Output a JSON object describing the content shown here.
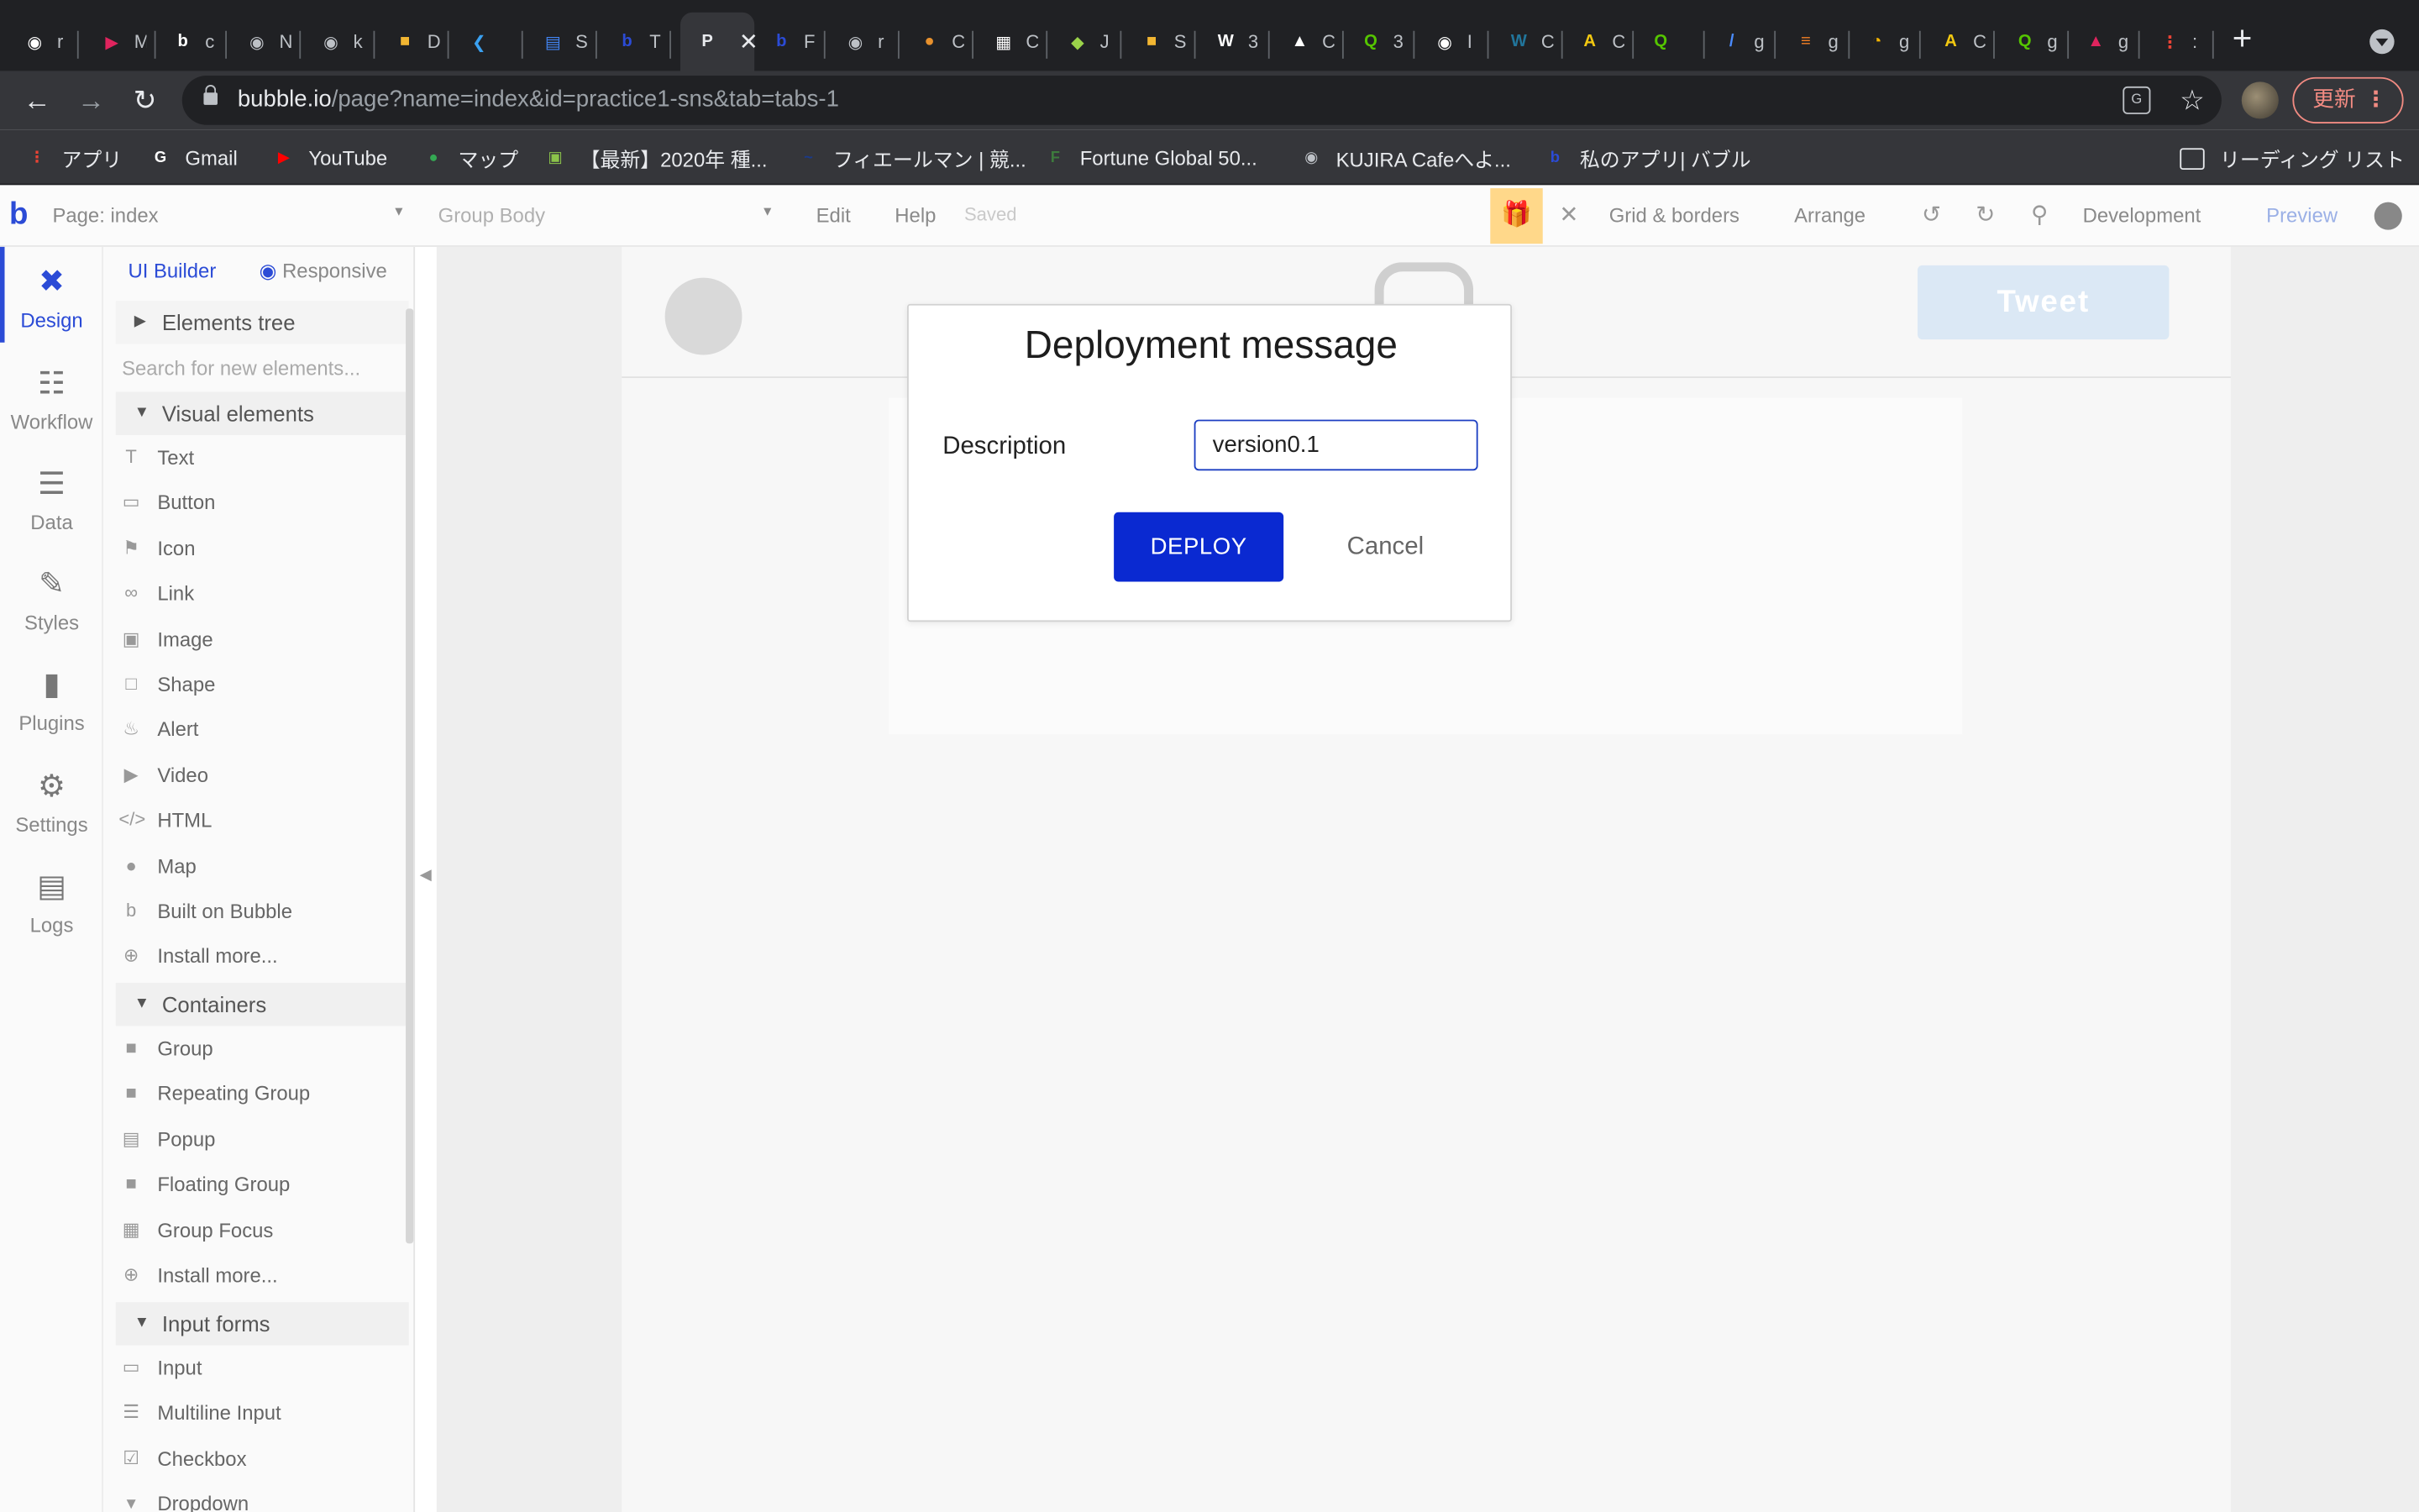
{
  "browser": {
    "tabs": [
      {
        "title": "r",
        "icon": "github-icon",
        "color": "#ffffff"
      },
      {
        "title": "M",
        "icon": "play-icon",
        "color": "#e0245e"
      },
      {
        "title": "c",
        "icon": "bubble-icon",
        "color": "#ffffff"
      },
      {
        "title": "N",
        "icon": "globe-icon",
        "color": "#bdc1c6"
      },
      {
        "title": "k",
        "icon": "globe-icon",
        "color": "#bdc1c6"
      },
      {
        "title": "D",
        "icon": "puzzle-icon",
        "color": "#f2b632"
      },
      {
        "title": "",
        "icon": "vscode-icon",
        "color": "#3aa0f0"
      },
      {
        "title": "S",
        "icon": "docs-icon",
        "color": "#4285f4"
      },
      {
        "title": "T",
        "icon": "bubble-icon",
        "color": "#2b4bd6"
      },
      {
        "title": "P",
        "icon": "page-icon",
        "color": "#35363a",
        "active": true
      },
      {
        "title": "F",
        "icon": "bubble-icon",
        "color": "#2b4bd6"
      },
      {
        "title": "r",
        "icon": "globe-icon",
        "color": "#bdc1c6"
      },
      {
        "title": "C",
        "icon": "circle-icon",
        "color": "#e8912d"
      },
      {
        "title": "C",
        "icon": "grid-icon",
        "color": "#ffffff"
      },
      {
        "title": "J",
        "icon": "leaf-icon",
        "color": "#9bd34a"
      },
      {
        "title": "S",
        "icon": "puzzle-icon",
        "color": "#f2b632"
      },
      {
        "title": "3",
        "icon": "w-icon",
        "color": "#ffffff"
      },
      {
        "title": "C",
        "icon": "unity-icon",
        "color": "#ffffff"
      },
      {
        "title": "3",
        "icon": "qiita-icon",
        "color": "#55c500"
      },
      {
        "title": "I",
        "icon": "github-icon",
        "color": "#ffffff"
      },
      {
        "title": "C",
        "icon": "wordpress-icon",
        "color": "#21759b"
      },
      {
        "title": "C",
        "icon": "a-icon",
        "color": "#f2c811"
      },
      {
        "title": "",
        "icon": "qiita-icon",
        "color": "#55c500"
      },
      {
        "title": "g",
        "icon": "slash-icon",
        "color": "#4a8cff"
      },
      {
        "title": "g",
        "icon": "stack-icon",
        "color": "#f48024"
      },
      {
        "title": "g",
        "icon": "colorwheel-icon",
        "color": "#f4b400"
      },
      {
        "title": "C",
        "icon": "a-icon",
        "color": "#f2c811"
      },
      {
        "title": "g",
        "icon": "qiita-icon",
        "color": "#55c500"
      },
      {
        "title": "g",
        "icon": "triangle-icon",
        "color": "#e0245e"
      },
      {
        "title": ":",
        "icon": "apps-icon",
        "color": "#ea4335"
      }
    ],
    "active_tab_title": "P",
    "url_host": "bubble.io",
    "url_path": "/page?name=index&id=practice1-sns&tab=tabs-1",
    "update_label": "更新",
    "bookmarks": [
      {
        "label": "アプリ",
        "icon": "apps-icon",
        "color": "#ea4335"
      },
      {
        "label": "Gmail",
        "icon": "google-icon",
        "color": "#ffffff"
      },
      {
        "label": "YouTube",
        "icon": "youtube-icon",
        "color": "#ff0000"
      },
      {
        "label": "マップ",
        "icon": "maps-pin-icon",
        "color": "#34a853"
      },
      {
        "label": "【最新】2020年 種...",
        "icon": "image-icon",
        "color": "#8bc34a"
      },
      {
        "label": "フィエールマン | 競...",
        "icon": "jra-icon",
        "color": "#1a3a8a"
      },
      {
        "label": "Fortune Global 50...",
        "icon": "fortune-icon",
        "color": "#3d7b3d"
      },
      {
        "label": "KUJIRA Cafeへよ...",
        "icon": "globe-icon",
        "color": "#bdc1c6"
      },
      {
        "label": "私のアプリ| バブル",
        "icon": "bubble-icon",
        "color": "#2b4bd6"
      }
    ],
    "reading_list_label": "リーディング リスト"
  },
  "editor": {
    "page_selector": "Page: index",
    "element_selector": "Group Body",
    "menu": {
      "edit": "Edit",
      "help": "Help",
      "saved": "Saved"
    },
    "grid_borders": "Grid & borders",
    "arrange": "Arrange",
    "env": "Development",
    "preview": "Preview",
    "nav": [
      {
        "label": "Design",
        "icon": "design-icon",
        "active": true
      },
      {
        "label": "Workflow",
        "icon": "workflow-icon"
      },
      {
        "label": "Data",
        "icon": "database-icon"
      },
      {
        "label": "Styles",
        "icon": "brush-icon"
      },
      {
        "label": "Plugins",
        "icon": "plug-icon"
      },
      {
        "label": "Settings",
        "icon": "gear-icon"
      },
      {
        "label": "Logs",
        "icon": "document-icon"
      }
    ],
    "palette": {
      "tab_ui_builder": "UI Builder",
      "tab_responsive": "Responsive",
      "elements_tree": "Elements tree",
      "search_placeholder": "Search for new elements...",
      "visual_elements": "Visual elements",
      "visual_items": [
        {
          "label": "Text",
          "icon": "text-icon"
        },
        {
          "label": "Button",
          "icon": "button-icon"
        },
        {
          "label": "Icon",
          "icon": "flag-icon"
        },
        {
          "label": "Link",
          "icon": "link-icon"
        },
        {
          "label": "Image",
          "icon": "image-icon"
        },
        {
          "label": "Shape",
          "icon": "square-icon"
        },
        {
          "label": "Alert",
          "icon": "bell-icon"
        },
        {
          "label": "Video",
          "icon": "video-icon"
        },
        {
          "label": "HTML",
          "icon": "code-icon"
        },
        {
          "label": "Map",
          "icon": "pin-icon"
        },
        {
          "label": "Built on Bubble",
          "icon": "bubble-icon"
        },
        {
          "label": "Install more...",
          "icon": "plus-icon"
        }
      ],
      "containers": "Containers",
      "container_items": [
        {
          "label": "Group",
          "icon": "folder-icon"
        },
        {
          "label": "Repeating Group",
          "icon": "folder-icon"
        },
        {
          "label": "Popup",
          "icon": "window-icon"
        },
        {
          "label": "Floating Group",
          "icon": "folder-icon"
        },
        {
          "label": "Group Focus",
          "icon": "focus-icon"
        },
        {
          "label": "Install more...",
          "icon": "plus-icon"
        }
      ],
      "input_forms": "Input forms",
      "input_items": [
        {
          "label": "Input",
          "icon": "input-icon"
        },
        {
          "label": "Multiline Input",
          "icon": "multiline-icon"
        },
        {
          "label": "Checkbox",
          "icon": "checkbox-icon"
        },
        {
          "label": "Dropdown",
          "icon": "dropdown-icon"
        }
      ]
    },
    "canvas": {
      "tweet_label": "Tweet"
    }
  },
  "dialog": {
    "title": "Deployment message",
    "description_label": "Description",
    "description_value": "version0.1",
    "deploy_label": "DEPLOY",
    "cancel_label": "Cancel"
  }
}
